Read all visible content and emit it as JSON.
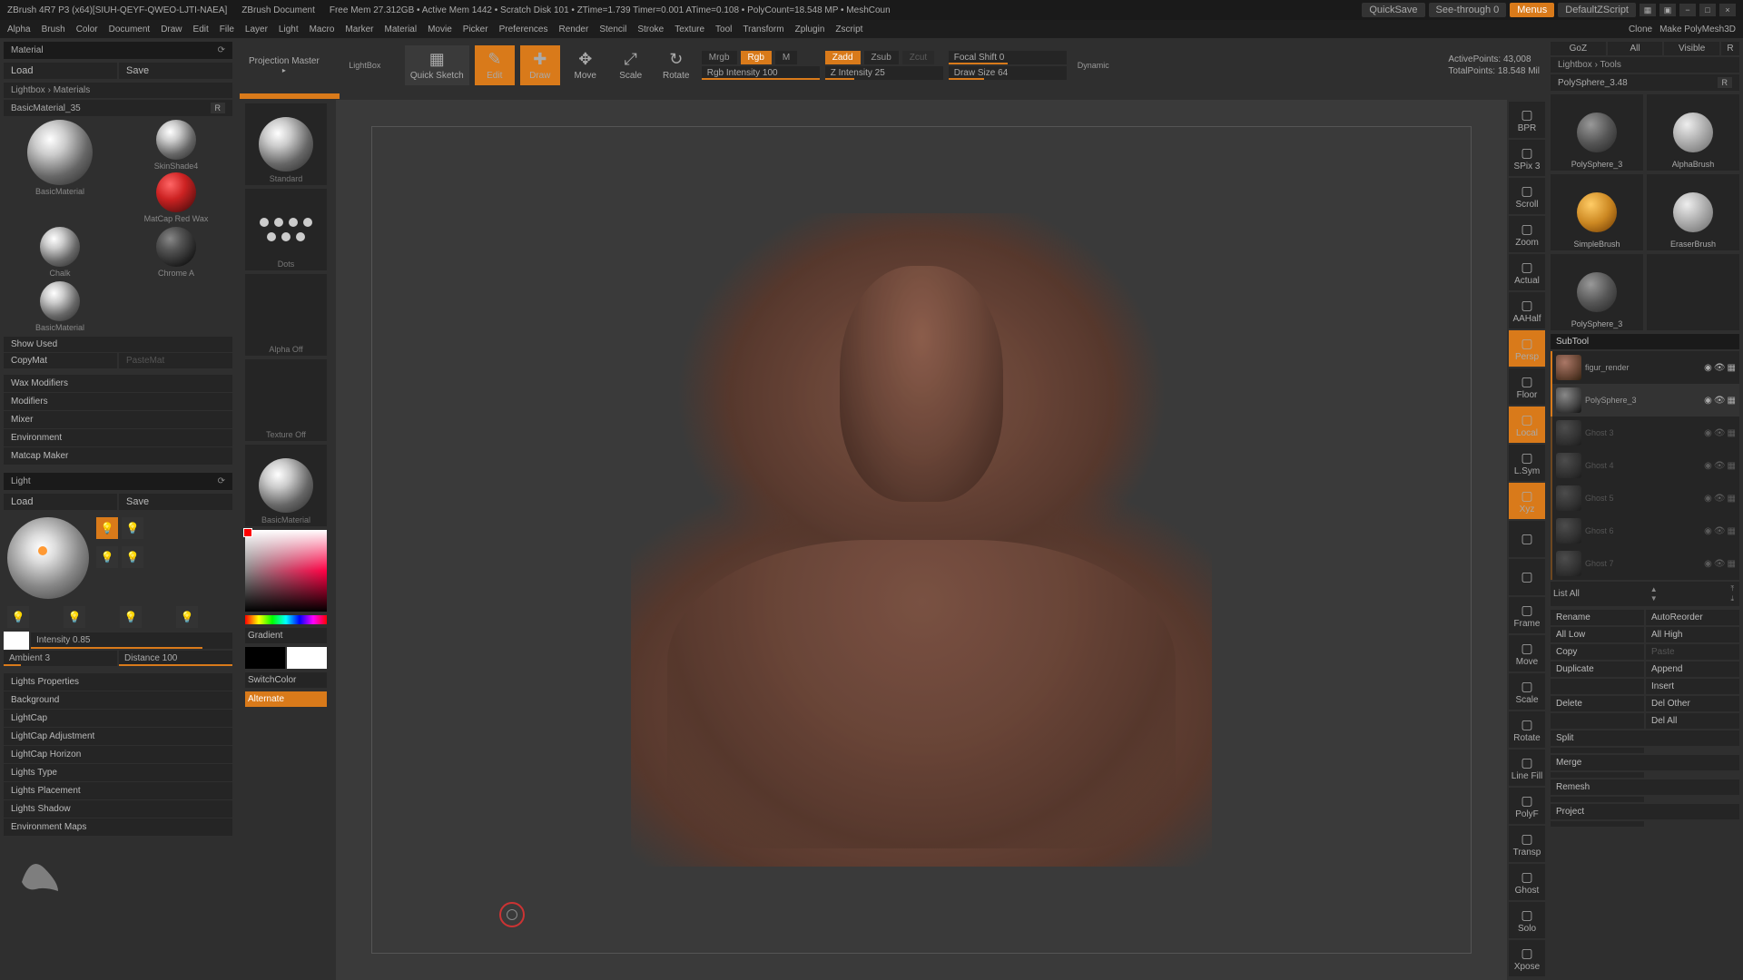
{
  "titlebar": {
    "app": "ZBrush 4R7 P3 (x64)[SIUH-QEYF-QWEO-LJTI-NAEA]",
    "doc": "ZBrush Document",
    "stats": "Free Mem 27.312GB • Active Mem 1442 • Scratch Disk 101 • ZTime=1.739 Timer=0.001 ATime=0.108 • PolyCount=18.548 MP • MeshCoun",
    "quicksave": "QuickSave",
    "seethrough": "See-through  0",
    "menus": "Menus",
    "script": "DefaultZScript"
  },
  "menubar": {
    "items": [
      "Alpha",
      "Brush",
      "Color",
      "Document",
      "Draw",
      "Edit",
      "File",
      "Layer",
      "Light",
      "Macro",
      "Marker",
      "Material",
      "Movie",
      "Picker",
      "Preferences",
      "Render",
      "Stencil",
      "Stroke",
      "Texture",
      "Tool",
      "Transform",
      "Zplugin",
      "Zscript"
    ],
    "right": [
      "Clone",
      "Make PolyMesh3D"
    ]
  },
  "material": {
    "title": "Material",
    "load": "Load",
    "save": "Save",
    "breadcrumb": "Lightbox › Materials",
    "current": "BasicMaterial_35",
    "r": "R",
    "names": [
      "BasicMaterial",
      "SkinShade4",
      "MatCap Red Wax",
      "Chalk",
      "Chrome A",
      "BasicMaterial"
    ],
    "showused": "Show Used",
    "copymat": "CopyMat",
    "pastemat": "PasteMat",
    "sections": [
      "Wax Modifiers",
      "Modifiers",
      "Mixer",
      "Environment",
      "Matcap Maker"
    ]
  },
  "light": {
    "title": "Light",
    "load": "Load",
    "save": "Save",
    "intensity_label": "Intensity 0.85",
    "ambient": "Ambient 3",
    "distance": "Distance 100",
    "sections": [
      "Lights Properties",
      "Background",
      "LightCap",
      "LightCap Adjustment",
      "LightCap Horizon",
      "Lights Type",
      "Lights Placement",
      "Lights Shadow",
      "Environment Maps"
    ]
  },
  "toolbar": {
    "projection": "Projection Master",
    "lightbox": "LightBox",
    "quicksketch": "Quick Sketch",
    "edit": "Edit",
    "draw": "Draw",
    "move": "Move",
    "scale": "Scale",
    "rotate": "Rotate",
    "mrgb": "Mrgb",
    "rgb": "Rgb",
    "m": "M",
    "rgbint": "Rgb Intensity 100",
    "zadd": "Zadd",
    "zsub": "Zsub",
    "zcut": "Zcut",
    "zint": "Z Intensity 25",
    "focal": "Focal Shift 0",
    "drawsize": "Draw Size 64",
    "dynamic": "Dynamic",
    "active": "ActivePoints: 43,008",
    "total": "TotalPoints: 18.548 Mil"
  },
  "leftstrip": {
    "standard": "Standard",
    "dots": "Dots",
    "alphaoff": "Alpha Off",
    "textureoff": "Texture Off",
    "basicmat": "BasicMaterial",
    "gradient": "Gradient",
    "switchcolor": "SwitchColor",
    "alternate": "Alternate"
  },
  "rightstrip": {
    "items": [
      "BPR",
      "SPix 3",
      "Scroll",
      "Zoom",
      "Actual",
      "AAHalf",
      "Persp",
      "Floor",
      "Local",
      "L.Sym",
      "Xyz",
      "",
      "",
      "Frame",
      "Move",
      "Scale",
      "Rotate",
      "Line Fill",
      "PolyF",
      "Transp",
      "Ghost",
      "Solo",
      "Xpose"
    ]
  },
  "rightpanel": {
    "toprow": [
      "GoZ",
      "All",
      "Visible",
      "R"
    ],
    "lightboxtools": "Lightbox › Tools",
    "current": "PolySphere_3.48",
    "r": "R",
    "tools": [
      "PolySphere_3",
      "AlphaBrush",
      "SimpleBrush",
      "EraserBrush",
      "PolySphere_3",
      ""
    ],
    "subtool": "SubTool",
    "subtools": [
      {
        "name": "figur_render"
      },
      {
        "name": "PolySphere_3"
      },
      {
        "name": "Ghost 3"
      },
      {
        "name": "Ghost 4"
      },
      {
        "name": "Ghost 5"
      },
      {
        "name": "Ghost 6"
      },
      {
        "name": "Ghost 7"
      }
    ],
    "listall": "List All",
    "actions": [
      "Rename",
      "AutoReorder",
      "All Low",
      "All High",
      "Copy",
      "Paste",
      "Duplicate",
      "Append",
      "",
      "Insert",
      "Delete",
      "Del Other",
      "",
      "Del All",
      "Split",
      "",
      "Merge",
      "",
      "Remesh",
      "",
      "Project",
      ""
    ]
  }
}
